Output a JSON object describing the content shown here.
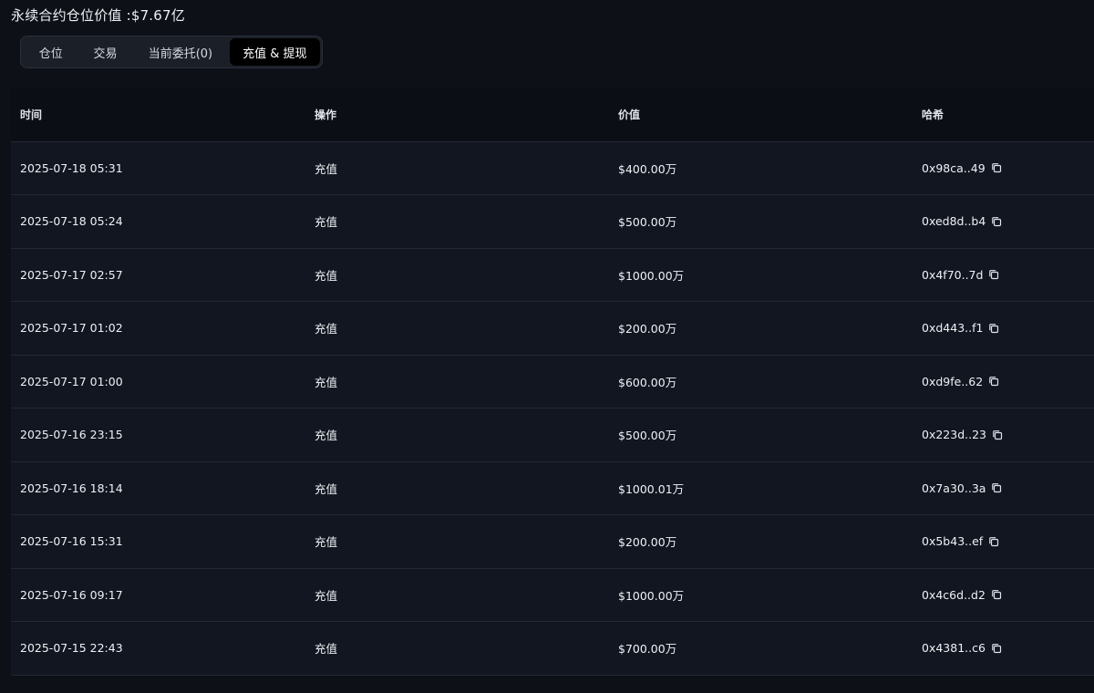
{
  "header": {
    "title": "永续合约仓位价值 :$7.67亿"
  },
  "tabs": [
    {
      "label": "仓位",
      "active": false
    },
    {
      "label": "交易",
      "active": false
    },
    {
      "label": "当前委托(0)",
      "active": false
    },
    {
      "label": "充值 & 提现",
      "active": true
    }
  ],
  "table": {
    "columns": [
      "时间",
      "操作",
      "价值",
      "哈希"
    ],
    "rows": [
      {
        "time": "2025-07-18 05:31",
        "op": "充值",
        "value": "$400.00万",
        "hash": "0x98ca..49",
        "icon": "copy-icon"
      },
      {
        "time": "2025-07-18 05:24",
        "op": "充值",
        "value": "$500.00万",
        "hash": "0xed8d..b4",
        "icon": "copy-icon"
      },
      {
        "time": "2025-07-17 02:57",
        "op": "充值",
        "value": "$1000.00万",
        "hash": "0x4f70..7d",
        "icon": "copy-icon"
      },
      {
        "time": "2025-07-17 01:02",
        "op": "充值",
        "value": "$200.00万",
        "hash": "0xd443..f1",
        "icon": "copy-icon"
      },
      {
        "time": "2025-07-17 01:00",
        "op": "充值",
        "value": "$600.00万",
        "hash": "0xd9fe..62",
        "icon": "copy-icon"
      },
      {
        "time": "2025-07-16 23:15",
        "op": "充值",
        "value": "$500.00万",
        "hash": "0x223d..23",
        "icon": "copy-icon"
      },
      {
        "time": "2025-07-16 18:14",
        "op": "充值",
        "value": "$1000.01万",
        "hash": "0x7a30..3a",
        "icon": "copy-icon"
      },
      {
        "time": "2025-07-16 15:31",
        "op": "充值",
        "value": "$200.00万",
        "hash": "0x5b43..ef",
        "icon": "copy-icon"
      },
      {
        "time": "2025-07-16 09:17",
        "op": "充值",
        "value": "$1000.00万",
        "hash": "0x4c6d..d2",
        "icon": "copy-icon"
      },
      {
        "time": "2025-07-15 22:43",
        "op": "充值",
        "value": "$700.00万",
        "hash": "0x4381..c6",
        "icon": "copy-icon"
      }
    ]
  },
  "colors": {
    "background": "#0d1017",
    "row_background": "#121620",
    "header_background": "#0b0e14",
    "active_tab": "#000000",
    "divider": "#232833"
  }
}
